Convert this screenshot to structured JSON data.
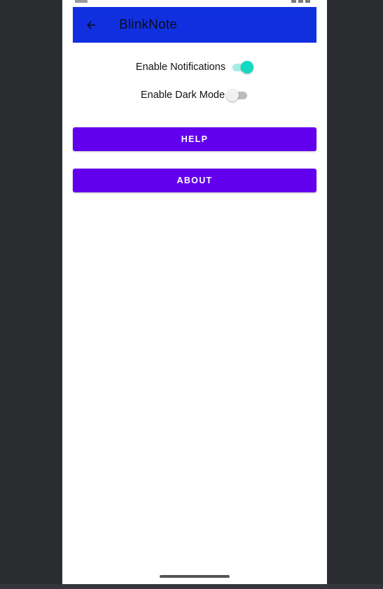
{
  "appbar": {
    "title": "BlinkNote",
    "back_icon": "arrow-back-icon",
    "background_color": "#1030e0"
  },
  "settings": [
    {
      "label": "Enable Notifications",
      "enabled": true
    },
    {
      "label": "Enable Dark Mode",
      "enabled": false
    }
  ],
  "buttons": {
    "help_label": "HELP",
    "about_label": "ABOUT",
    "color": "#6200ee"
  },
  "colors": {
    "switch_on_thumb": "#12d9c2",
    "switch_on_track": "#a6ece3"
  }
}
